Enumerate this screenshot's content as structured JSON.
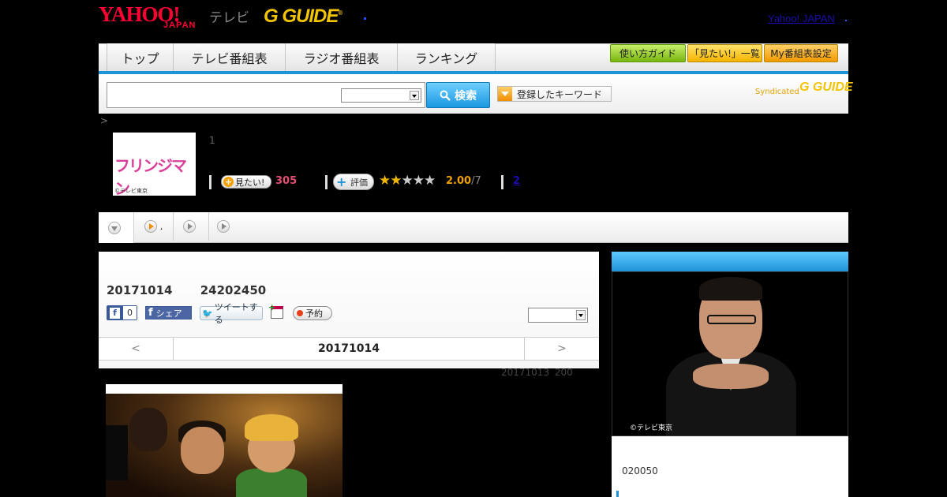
{
  "header": {
    "yahoo_logo": "YAHOO!",
    "japan_logo": "JAPAN",
    "tv_logo": "テレビ",
    "gguide_logo": "G GUIDE",
    "yahoo_japan_link": "Yahoo! JAPAN"
  },
  "nav": {
    "tabs": [
      {
        "label": "トップ"
      },
      {
        "label": "テレビ番組表"
      },
      {
        "label": "ラジオ番組表"
      },
      {
        "label": "ランキング"
      }
    ],
    "buttons": [
      {
        "label": "使い方ガイド"
      },
      {
        "label": "「見たい!」一覧"
      },
      {
        "label": "My番組表設定"
      }
    ]
  },
  "search": {
    "input_value": "",
    "select_value": "",
    "button_label": "検索",
    "keyword_button_label": "登録したキーワード",
    "syndicated_label": "Syndicated",
    "syndicated_logo": "G GUIDE"
  },
  "breadcrumb": ">",
  "program": {
    "thumb_title": "フリンジマン",
    "thumb_credit": "©テレビ東京",
    "episode_count": "1",
    "mitai_label": "見たい!",
    "mitai_count": "305",
    "rate_label": "評価",
    "rating_stars": 2,
    "rating_max_stars": 5,
    "rating_value": "2.00",
    "rating_denominator": "/7",
    "review_link": "2"
  },
  "subtabs": [
    {
      "label": ""
    },
    {
      "label": "."
    },
    {
      "label": ""
    },
    {
      "label": ""
    }
  ],
  "broadcast": {
    "date": "20171014",
    "time": "24202450",
    "fb_like_count": "0",
    "fb_share_label": "シェア",
    "tweet_label": "ツイートする",
    "reserve_label": "予約",
    "select_value": "",
    "prev_label": "<",
    "current_date": "20171014",
    "next_label": ">",
    "prev_info": "20171013  200"
  },
  "side": {
    "photo_credit": "©テレビ東京",
    "text": "020050"
  }
}
